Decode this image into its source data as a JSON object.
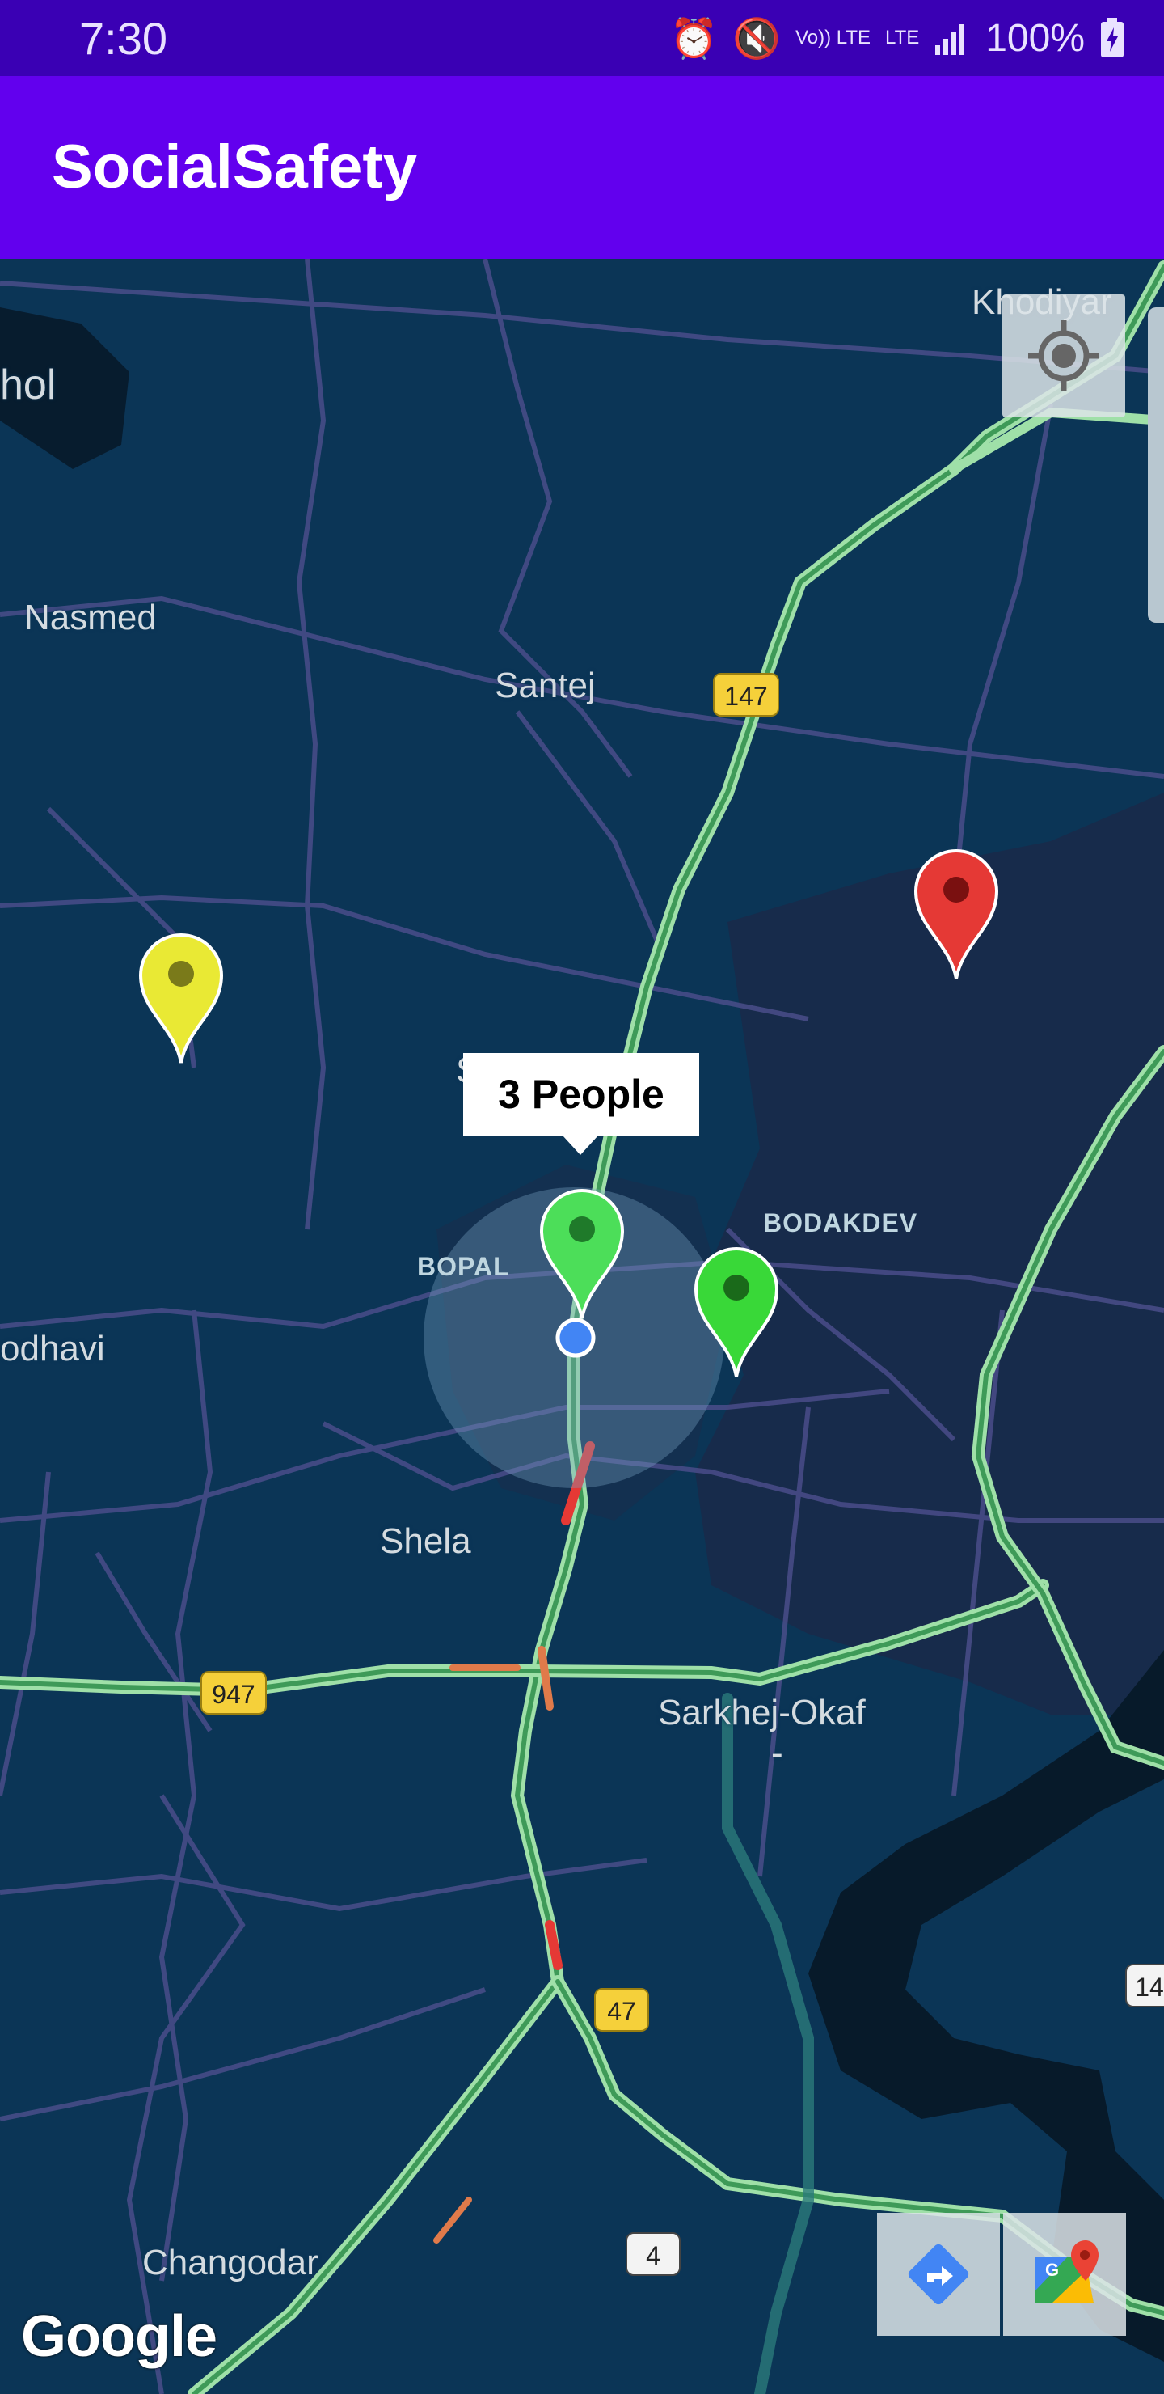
{
  "status_bar": {
    "time": "7:30",
    "volte_label": "Vo)) LTE",
    "lte_label": "LTE",
    "battery": "100%"
  },
  "app": {
    "title": "SocialSafety"
  },
  "map": {
    "places": {
      "khodiyar": "Khodiyar",
      "hol": "hol",
      "nasmed": "Nasmed",
      "santej": "Santej",
      "odhavi": "odhavi",
      "shela": "Shela",
      "sarkhej": "Sarkhej-Okaf",
      "sarkhej_dash": "-",
      "changodar": "Changodar",
      "bopal_s": "S"
    },
    "districts": {
      "bopal": "BOPAL",
      "bodakdev": "BODAKDEV"
    },
    "road_shields": {
      "r147": "147",
      "r947": "947",
      "r47": "47",
      "r4": "4",
      "r14": "14"
    },
    "callout": "3 People",
    "google": "Google",
    "marker_colors": {
      "yellow": "#e9e934",
      "red": "#e53935",
      "green1": "#4cde59",
      "green2": "#39d838"
    },
    "accent": "#6200ee",
    "status_bar_color": "#3a00b4"
  }
}
